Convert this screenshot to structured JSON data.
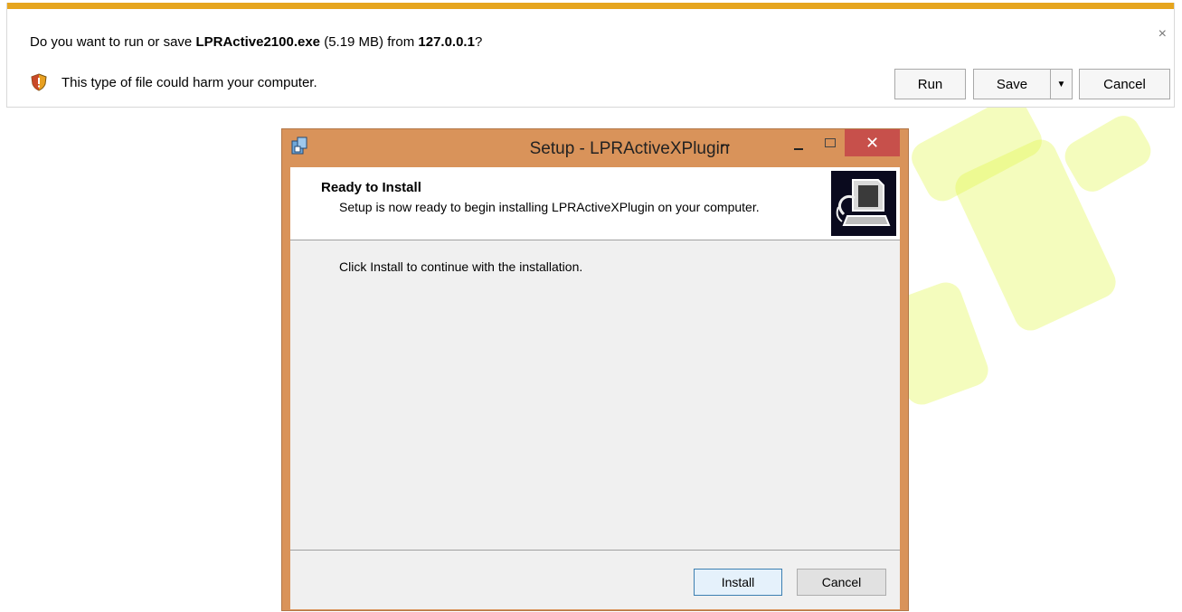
{
  "notification_bar": {
    "question_prefix": "Do you want to run or save ",
    "file_name": "LPRActive2100.exe",
    "file_size": " (5.19 MB) from ",
    "source_host": "127.0.0.1",
    "question_suffix": "?",
    "warning_text": "This type of file could harm your computer.",
    "close_glyph": "×",
    "buttons": {
      "run": "Run",
      "save": "Save",
      "save_dropdown_glyph": "▼",
      "cancel": "Cancel"
    },
    "accent_color": "#e6a51e"
  },
  "setup_window": {
    "title": "Setup - LPRActiveXPlugin",
    "resize_cursor_glyph": "↔",
    "close_glyph": "✕",
    "header": {
      "title": "Ready to Install",
      "subtitle": "Setup is now ready to begin installing LPRActiveXPlugin on your computer."
    },
    "body_text": "Click Install to continue with the installation.",
    "buttons": {
      "install": "Install",
      "cancel": "Cancel"
    },
    "frame_color": "#d9935a",
    "close_color": "#c7504b"
  }
}
